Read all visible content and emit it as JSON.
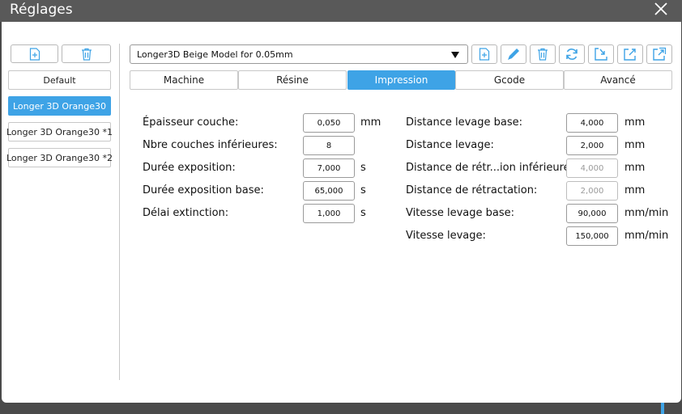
{
  "window": {
    "title": "Réglages",
    "close_icon": "close-icon"
  },
  "presets": {
    "add_icon": "file-plus-icon",
    "delete_icon": "trash-icon",
    "items": [
      {
        "label": "Default",
        "active": false
      },
      {
        "label": "Longer 3D Orange30",
        "active": true
      },
      {
        "label": "Longer 3D Orange30 *1",
        "active": false
      },
      {
        "label": "Longer 3D Orange30 *2",
        "active": false
      }
    ]
  },
  "profile": {
    "selected": "Longer3D Beige Model for 0.05mm",
    "toolbar_icons": [
      "file-plus-icon",
      "pencil-icon",
      "trash-icon",
      "refresh-icon",
      "import-icon",
      "export-icon",
      "export-all-icon"
    ]
  },
  "tabs": [
    {
      "label": "Machine",
      "active": false
    },
    {
      "label": "Résine",
      "active": false
    },
    {
      "label": "Impression",
      "active": true
    },
    {
      "label": "Gcode",
      "active": false
    },
    {
      "label": "Avancé",
      "active": false
    }
  ],
  "params_left": [
    {
      "label": "Épaisseur couche:",
      "value": "0,050",
      "unit": "mm"
    },
    {
      "label": "Nbre couches inférieures:",
      "value": "8",
      "unit": ""
    },
    {
      "label": "Durée exposition:",
      "value": "7,000",
      "unit": "s"
    },
    {
      "label": "Durée exposition base:",
      "value": "65,000",
      "unit": "s"
    },
    {
      "label": "Délai extinction:",
      "value": "1,000",
      "unit": "s"
    }
  ],
  "params_right": [
    {
      "label": "Distance levage base:",
      "value": "4,000",
      "unit": "mm",
      "disabled": false
    },
    {
      "label": "Distance levage:",
      "value": "2,000",
      "unit": "mm",
      "disabled": false
    },
    {
      "label": "Distance de rétr...ion inférieure :",
      "value": "4,000",
      "unit": "mm",
      "disabled": true
    },
    {
      "label": "Distance de rétractation:",
      "value": "2,000",
      "unit": "mm",
      "disabled": true
    },
    {
      "label": "Vitesse levage base:",
      "value": "90,000",
      "unit": "mm/min",
      "disabled": false
    },
    {
      "label": "Vitesse levage:",
      "value": "150,000",
      "unit": "mm/min",
      "disabled": false
    }
  ],
  "colors": {
    "accent": "#3ea3e6",
    "titlebar": "#595959",
    "icon_blue": "#3ea3e6"
  }
}
